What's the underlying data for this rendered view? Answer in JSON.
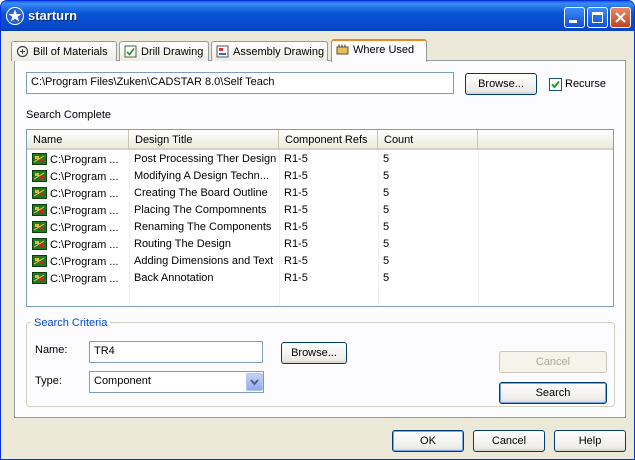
{
  "window": {
    "title": "starturn",
    "icon": "star-icon"
  },
  "tabs": [
    {
      "label": "Bill of Materials",
      "icon": "bill-icon",
      "active": false
    },
    {
      "label": "Drill Drawing",
      "icon": "drill-icon",
      "active": false
    },
    {
      "label": "Assembly Drawing",
      "icon": "assembly-icon",
      "active": false
    },
    {
      "label": "Where Used",
      "icon": "where-used-icon",
      "active": true
    }
  ],
  "path": {
    "value": "C:\\Program Files\\Zuken\\CADSTAR 8.0\\Self Teach"
  },
  "browse_label": "Browse...",
  "recurse": {
    "label": "Recurse",
    "checked": true
  },
  "status": "Search Complete",
  "table": {
    "columns": [
      "Name",
      "Design Title",
      "Component Refs",
      "Count"
    ],
    "rows": [
      [
        "C:\\Program ...",
        "Post Processing Ther Design",
        "R1-5",
        "5"
      ],
      [
        "C:\\Program ...",
        "Modifying A Design Techn...",
        "R1-5",
        "5"
      ],
      [
        "C:\\Program ...",
        "Creating The Board Outline",
        "R1-5",
        "5"
      ],
      [
        "C:\\Program ...",
        "Placing The Compomnents",
        "R1-5",
        "5"
      ],
      [
        "C:\\Program ...",
        "Renaming The Components",
        "R1-5",
        "5"
      ],
      [
        "C:\\Program ...",
        "Routing The Design",
        "R1-5",
        "5"
      ],
      [
        "C:\\Program ...",
        "Adding Dimensions and Text",
        "R1-5",
        "5"
      ],
      [
        "C:\\Program ...",
        "Back Annotation",
        "R1-5",
        "5"
      ]
    ]
  },
  "criteria": {
    "title": "Search Criteria",
    "name_label": "Name:",
    "name_value": "TR4",
    "type_label": "Type:",
    "type_value": "Component",
    "cancel_label": "Cancel",
    "search_label": "Search"
  },
  "footer": {
    "ok": "OK",
    "cancel": "Cancel",
    "help": "Help"
  },
  "colors": {
    "title_bar": "#0a55d8",
    "close_button": "#c4401b",
    "group_title": "#0046d5",
    "active_tab_accent": "#e68b2c"
  }
}
